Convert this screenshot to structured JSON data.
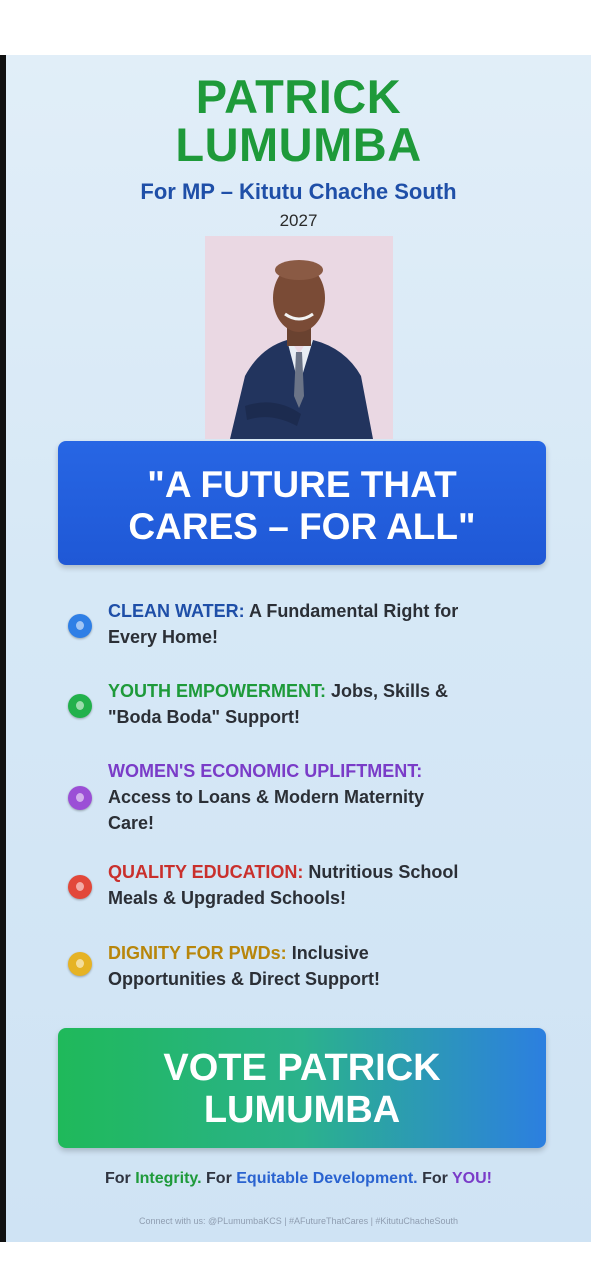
{
  "header": {
    "name_line1": "PATRICK",
    "name_line2": "LUMUMBA",
    "subtitle": "For MP – Kitutu Chache South",
    "year": "2027"
  },
  "slogan": {
    "line1": "\"A FUTURE THAT",
    "line2": "CARES – FOR ALL\""
  },
  "points": [
    {
      "icon": "water-drop-icon",
      "color": "#2f7fe6",
      "label_color": "#1f4fa8",
      "label": "CLEAN WATER:",
      "line1_rest": " A Fundamental Right for",
      "line2": "Every Home!"
    },
    {
      "icon": "leaf-icon",
      "color": "#22b14c",
      "label_color": "#1e9a3a",
      "label": "YOUTH EMPOWERMENT:",
      "line1_rest": " Jobs, Skills &",
      "line2": "\"Boda Boda\" Support!"
    },
    {
      "icon": "women-icon",
      "color": "#9b4fd6",
      "label_color": "#7a3cc8",
      "label": "WOMEN'S ECONOMIC UPLIFTMENT:",
      "line1_rest": "",
      "line2": "Access to Loans & Modern Maternity",
      "line3": "Care!"
    },
    {
      "icon": "flame-icon",
      "color": "#e2483a",
      "label_color": "#c9302c",
      "label": "QUALITY EDUCATION:",
      "line1_rest": " Nutritious School",
      "line2": "Meals & Upgraded Schools!"
    },
    {
      "icon": "accessibility-icon",
      "color": "#e6b325",
      "label_color": "#b8860b",
      "label": "DIGNITY FOR PWDs:",
      "line1_rest": " Inclusive",
      "line2": "Opportunities & Direct Support!"
    }
  ],
  "vote": {
    "line1": "VOTE PATRICK",
    "line2": "LUMUMBA"
  },
  "tagline": {
    "part1": "For ",
    "integrity": "Integrity.",
    "part2": " For ",
    "development": "Equitable Development.",
    "part3": " For ",
    "you": "YOU!"
  },
  "footer": "Connect with us: @PLumumbaKCS | #AFutureThatCares | #KitutuChacheSouth"
}
